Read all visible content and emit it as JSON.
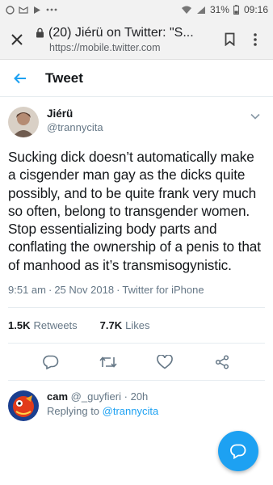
{
  "status_bar": {
    "battery": "31%",
    "time": "09:16"
  },
  "browser": {
    "title": "(20) Jiérü on Twitter: \"S...",
    "url": "https://mobile.twitter.com"
  },
  "header": {
    "title": "Tweet"
  },
  "tweet": {
    "author_name": "Jiérü",
    "author_handle": "@trannycita",
    "text": "Sucking dick doesn’t automatically make a cisgender man gay as the dicks quite possibly, and to be quite frank very much so often, belong to transgender women. Stop essentializing body parts and conflating the ownership of a penis to that of manhood as it’s transmisogynistic.",
    "time": "9:51 am",
    "date": "25 Nov 2018",
    "source": "Twitter for iPhone",
    "retweets_count": "1.5K",
    "retweets_label": "Retweets",
    "likes_count": "7.7K",
    "likes_label": "Likes"
  },
  "reply": {
    "name": "cam",
    "handle": "@_guyfieri",
    "time": "20h",
    "replying_prefix": "Replying to",
    "replying_handle": "@trannycita"
  },
  "colors": {
    "accent": "#1da1f2",
    "muted": "#657786",
    "text": "#14171a"
  }
}
